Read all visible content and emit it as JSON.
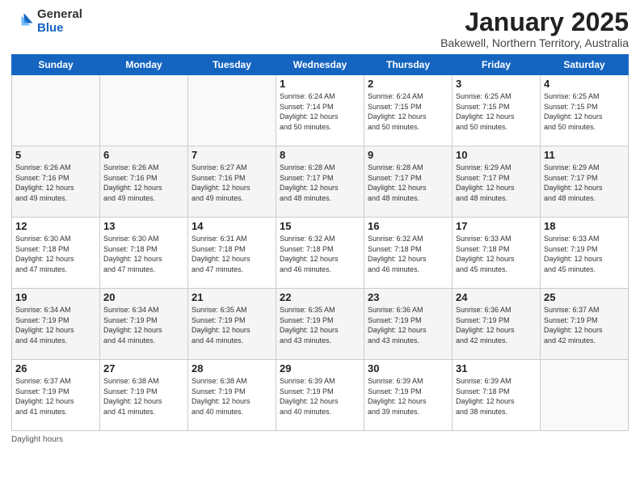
{
  "logo": {
    "general": "General",
    "blue": "Blue"
  },
  "title": "January 2025",
  "subtitle": "Bakewell, Northern Territory, Australia",
  "days_of_week": [
    "Sunday",
    "Monday",
    "Tuesday",
    "Wednesday",
    "Thursday",
    "Friday",
    "Saturday"
  ],
  "footer": {
    "daylight_label": "Daylight hours"
  },
  "weeks": [
    [
      {
        "day": "",
        "info": ""
      },
      {
        "day": "",
        "info": ""
      },
      {
        "day": "",
        "info": ""
      },
      {
        "day": "1",
        "info": "Sunrise: 6:24 AM\nSunset: 7:14 PM\nDaylight: 12 hours\nand 50 minutes."
      },
      {
        "day": "2",
        "info": "Sunrise: 6:24 AM\nSunset: 7:15 PM\nDaylight: 12 hours\nand 50 minutes."
      },
      {
        "day": "3",
        "info": "Sunrise: 6:25 AM\nSunset: 7:15 PM\nDaylight: 12 hours\nand 50 minutes."
      },
      {
        "day": "4",
        "info": "Sunrise: 6:25 AM\nSunset: 7:15 PM\nDaylight: 12 hours\nand 50 minutes."
      }
    ],
    [
      {
        "day": "5",
        "info": "Sunrise: 6:26 AM\nSunset: 7:16 PM\nDaylight: 12 hours\nand 49 minutes."
      },
      {
        "day": "6",
        "info": "Sunrise: 6:26 AM\nSunset: 7:16 PM\nDaylight: 12 hours\nand 49 minutes."
      },
      {
        "day": "7",
        "info": "Sunrise: 6:27 AM\nSunset: 7:16 PM\nDaylight: 12 hours\nand 49 minutes."
      },
      {
        "day": "8",
        "info": "Sunrise: 6:28 AM\nSunset: 7:17 PM\nDaylight: 12 hours\nand 48 minutes."
      },
      {
        "day": "9",
        "info": "Sunrise: 6:28 AM\nSunset: 7:17 PM\nDaylight: 12 hours\nand 48 minutes."
      },
      {
        "day": "10",
        "info": "Sunrise: 6:29 AM\nSunset: 7:17 PM\nDaylight: 12 hours\nand 48 minutes."
      },
      {
        "day": "11",
        "info": "Sunrise: 6:29 AM\nSunset: 7:17 PM\nDaylight: 12 hours\nand 48 minutes."
      }
    ],
    [
      {
        "day": "12",
        "info": "Sunrise: 6:30 AM\nSunset: 7:18 PM\nDaylight: 12 hours\nand 47 minutes."
      },
      {
        "day": "13",
        "info": "Sunrise: 6:30 AM\nSunset: 7:18 PM\nDaylight: 12 hours\nand 47 minutes."
      },
      {
        "day": "14",
        "info": "Sunrise: 6:31 AM\nSunset: 7:18 PM\nDaylight: 12 hours\nand 47 minutes."
      },
      {
        "day": "15",
        "info": "Sunrise: 6:32 AM\nSunset: 7:18 PM\nDaylight: 12 hours\nand 46 minutes."
      },
      {
        "day": "16",
        "info": "Sunrise: 6:32 AM\nSunset: 7:18 PM\nDaylight: 12 hours\nand 46 minutes."
      },
      {
        "day": "17",
        "info": "Sunrise: 6:33 AM\nSunset: 7:18 PM\nDaylight: 12 hours\nand 45 minutes."
      },
      {
        "day": "18",
        "info": "Sunrise: 6:33 AM\nSunset: 7:19 PM\nDaylight: 12 hours\nand 45 minutes."
      }
    ],
    [
      {
        "day": "19",
        "info": "Sunrise: 6:34 AM\nSunset: 7:19 PM\nDaylight: 12 hours\nand 44 minutes."
      },
      {
        "day": "20",
        "info": "Sunrise: 6:34 AM\nSunset: 7:19 PM\nDaylight: 12 hours\nand 44 minutes."
      },
      {
        "day": "21",
        "info": "Sunrise: 6:35 AM\nSunset: 7:19 PM\nDaylight: 12 hours\nand 44 minutes."
      },
      {
        "day": "22",
        "info": "Sunrise: 6:35 AM\nSunset: 7:19 PM\nDaylight: 12 hours\nand 43 minutes."
      },
      {
        "day": "23",
        "info": "Sunrise: 6:36 AM\nSunset: 7:19 PM\nDaylight: 12 hours\nand 43 minutes."
      },
      {
        "day": "24",
        "info": "Sunrise: 6:36 AM\nSunset: 7:19 PM\nDaylight: 12 hours\nand 42 minutes."
      },
      {
        "day": "25",
        "info": "Sunrise: 6:37 AM\nSunset: 7:19 PM\nDaylight: 12 hours\nand 42 minutes."
      }
    ],
    [
      {
        "day": "26",
        "info": "Sunrise: 6:37 AM\nSunset: 7:19 PM\nDaylight: 12 hours\nand 41 minutes."
      },
      {
        "day": "27",
        "info": "Sunrise: 6:38 AM\nSunset: 7:19 PM\nDaylight: 12 hours\nand 41 minutes."
      },
      {
        "day": "28",
        "info": "Sunrise: 6:38 AM\nSunset: 7:19 PM\nDaylight: 12 hours\nand 40 minutes."
      },
      {
        "day": "29",
        "info": "Sunrise: 6:39 AM\nSunset: 7:19 PM\nDaylight: 12 hours\nand 40 minutes."
      },
      {
        "day": "30",
        "info": "Sunrise: 6:39 AM\nSunset: 7:19 PM\nDaylight: 12 hours\nand 39 minutes."
      },
      {
        "day": "31",
        "info": "Sunrise: 6:39 AM\nSunset: 7:18 PM\nDaylight: 12 hours\nand 38 minutes."
      },
      {
        "day": "",
        "info": ""
      }
    ]
  ]
}
